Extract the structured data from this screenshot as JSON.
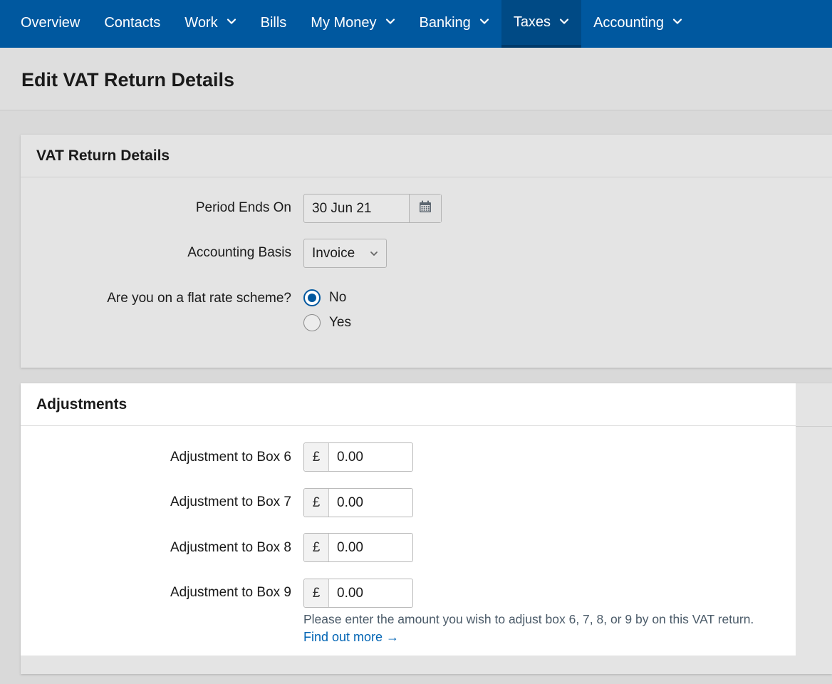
{
  "nav": {
    "items": [
      {
        "label": "Overview",
        "dropdown": false
      },
      {
        "label": "Contacts",
        "dropdown": false
      },
      {
        "label": "Work",
        "dropdown": true
      },
      {
        "label": "Bills",
        "dropdown": false
      },
      {
        "label": "My Money",
        "dropdown": true
      },
      {
        "label": "Banking",
        "dropdown": true
      },
      {
        "label": "Taxes",
        "dropdown": true,
        "active": true
      },
      {
        "label": "Accounting",
        "dropdown": true
      }
    ],
    "color": "#00589f"
  },
  "page": {
    "title": "Edit VAT Return Details"
  },
  "vat_details": {
    "heading": "VAT Return Details",
    "period_label": "Period Ends On",
    "period_value": "30 Jun 21",
    "calendar_icon": "calendar-icon",
    "basis_label": "Accounting Basis",
    "basis_value": "Invoice",
    "flat_rate_label": "Are you on a flat rate scheme?",
    "flat_rate_options": [
      {
        "label": "No",
        "checked": true
      },
      {
        "label": "Yes",
        "checked": false
      }
    ]
  },
  "adjustments": {
    "heading": "Adjustments",
    "currency": "£",
    "rows": [
      {
        "label": "Adjustment to Box 6",
        "value": "0.00"
      },
      {
        "label": "Adjustment to Box 7",
        "value": "0.00"
      },
      {
        "label": "Adjustment to Box 8",
        "value": "0.00"
      },
      {
        "label": "Adjustment to Box 9",
        "value": "0.00"
      }
    ],
    "help_text": "Please enter the amount you wish to adjust box 6, 7, 8, or 9 by on this VAT return.",
    "find_more": "Find out more →"
  }
}
